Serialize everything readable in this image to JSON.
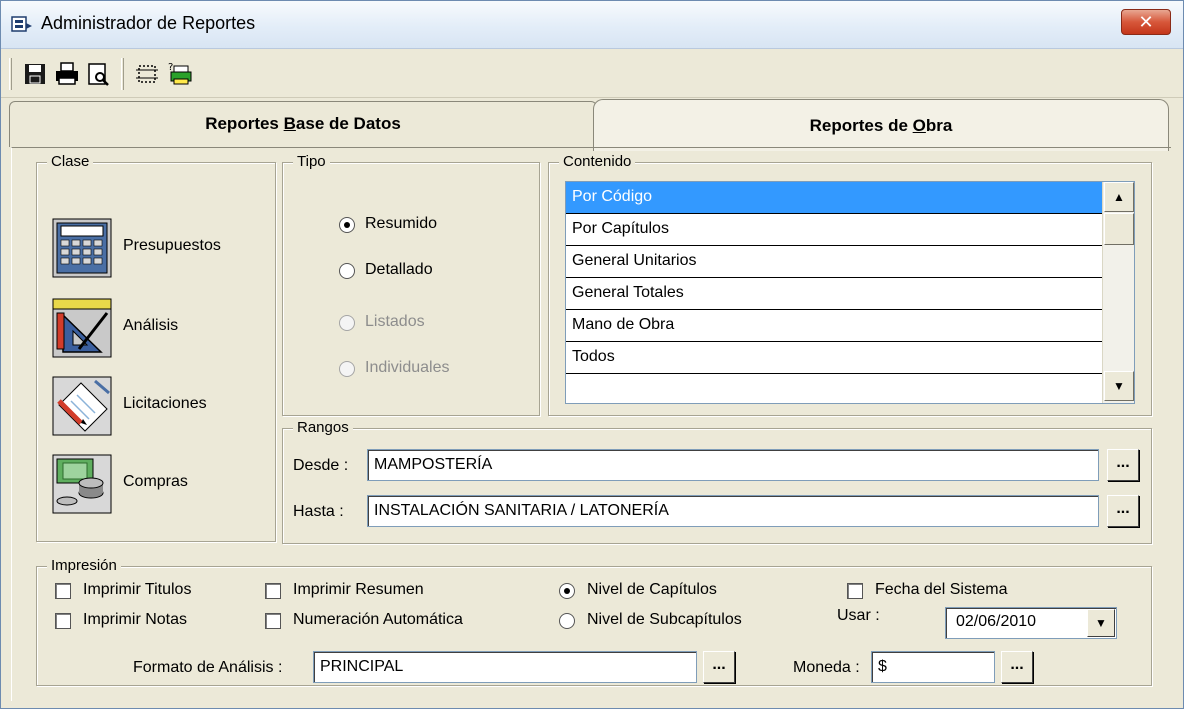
{
  "window": {
    "title": "Administrador de Reportes",
    "close_glyph": "✕"
  },
  "toolbar": {
    "buttons": [
      {
        "name": "save-icon"
      },
      {
        "name": "print-icon"
      },
      {
        "name": "print-preview-icon"
      },
      {
        "name": "select-area-icon"
      },
      {
        "name": "printer-setup-icon"
      }
    ]
  },
  "tabs": {
    "base_datos": {
      "pre": "Reportes ",
      "key": "B",
      "post": "ase de Datos"
    },
    "obra": {
      "pre": "Reportes de ",
      "key": "O",
      "post": "bra"
    },
    "active": "obra"
  },
  "clase": {
    "label": "Clase",
    "items": [
      {
        "label": "Presupuestos",
        "icon": "calculator-icon"
      },
      {
        "label": "Análisis",
        "icon": "drafting-tools-icon"
      },
      {
        "label": "Licitaciones",
        "icon": "document-pen-icon"
      },
      {
        "label": "Compras",
        "icon": "money-coins-icon"
      }
    ]
  },
  "tipo": {
    "label": "Tipo",
    "options": [
      {
        "label": "Resumido",
        "checked": true,
        "enabled": true
      },
      {
        "label": "Detallado",
        "checked": false,
        "enabled": true
      },
      {
        "label": "Listados",
        "checked": false,
        "enabled": false
      },
      {
        "label": "Individuales",
        "checked": false,
        "enabled": false
      }
    ]
  },
  "contenido": {
    "label": "Contenido",
    "items": [
      "Por Código",
      "Por Capítulos",
      "General Unitarios",
      "General Totales",
      "Mano de Obra",
      "Todos"
    ],
    "selected_index": 0
  },
  "rangos": {
    "label": "Rangos",
    "desde_label": "Desde :",
    "desde_value": "MAMPOSTERÍA",
    "hasta_label": "Hasta :",
    "hasta_value": "INSTALACIÓN SANITARIA / LATONERÍA",
    "browse_label": "..."
  },
  "impresion": {
    "label": "Impresión",
    "checkboxes": {
      "imprimir_titulos": "Imprimir Titulos",
      "imprimir_notas": "Imprimir Notas",
      "imprimir_resumen": "Imprimir Resumen",
      "numeracion_automatica": "Numeración Automática",
      "fecha_sistema": "Fecha del Sistema"
    },
    "nivel": {
      "capitulos": "Nivel de Capítulos",
      "subcapitulos": "Nivel de Subcapítulos",
      "selected": "capitulos"
    },
    "usar_label": "Usar :",
    "fecha_value": "02/06/2010",
    "formato_label": "Formato de Análisis :",
    "formato_value": "PRINCIPAL",
    "moneda_label": "Moneda :",
    "moneda_value": "$",
    "browse_label": "..."
  }
}
